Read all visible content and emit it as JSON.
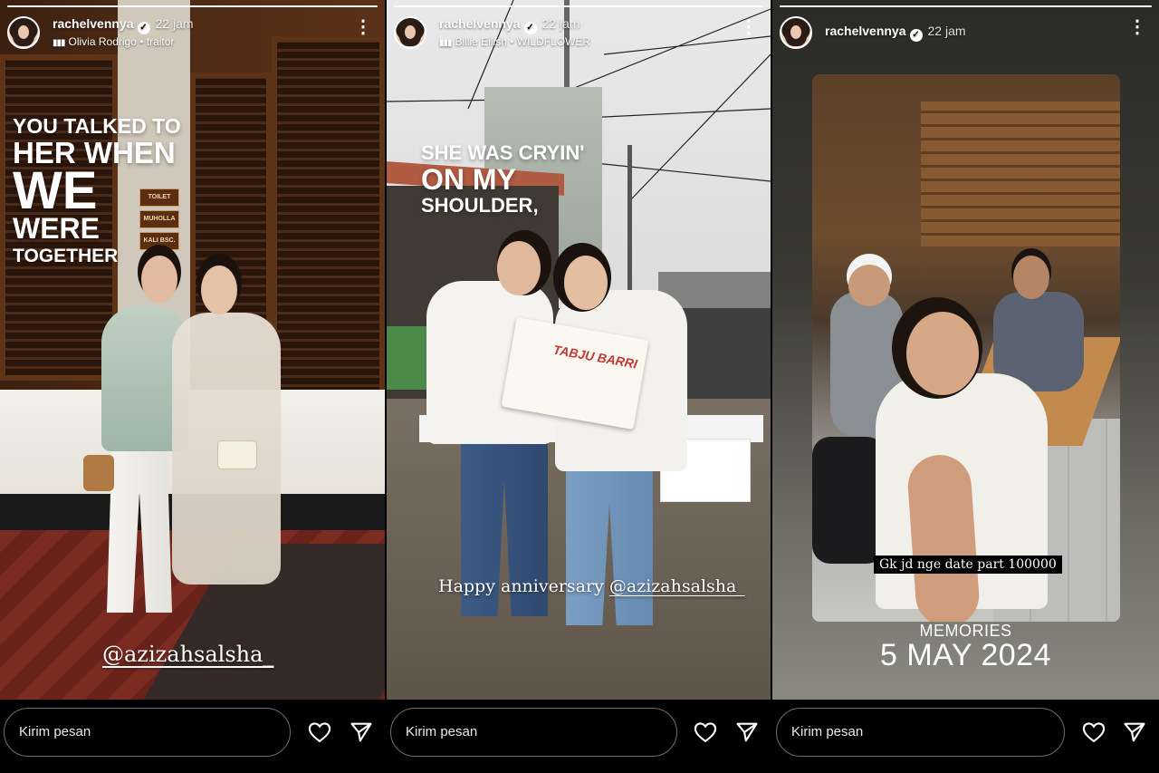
{
  "stories": [
    {
      "username": "rachelvennya",
      "time": "22 jam",
      "music": "Olivia Rodrigo • traitor",
      "caption": [
        "YOU TALKED TO",
        "HER WHEN",
        "WE",
        "WERE",
        "TOGETHER"
      ],
      "mention": "@azizahsalsha_",
      "message_placeholder": "Kirim pesan",
      "signs": [
        "TOILET",
        "MUHOLLA",
        "KALI BSC."
      ]
    },
    {
      "username": "rachelvennya",
      "time": "22 jam",
      "music": "Billie Eilish • WILDFLOWER",
      "caption": [
        "SHE WAS CRYIN'",
        "ON MY",
        "SHOULDER,"
      ],
      "mention_prefix": "Happy anniversary ",
      "mention": "@azizahsalsha_",
      "sign_text": "TABJU BARRI",
      "message_placeholder": "Kirim pesan"
    },
    {
      "username": "rachelvennya",
      "time": "22 jam",
      "photo_caption": "Gk jd nge date part 100000",
      "memories_label": "MEMORIES",
      "date": "5 MAY 2024",
      "message_placeholder": "Kirim pesan"
    }
  ],
  "icons": {
    "verified": "verified-badge-icon",
    "music": "music-bars-icon",
    "more": "more-vertical-icon",
    "like": "heart-icon",
    "send": "send-icon"
  },
  "colors": {
    "background": "#000000",
    "text": "#ffffff",
    "input_border": "#6e6e6e"
  }
}
